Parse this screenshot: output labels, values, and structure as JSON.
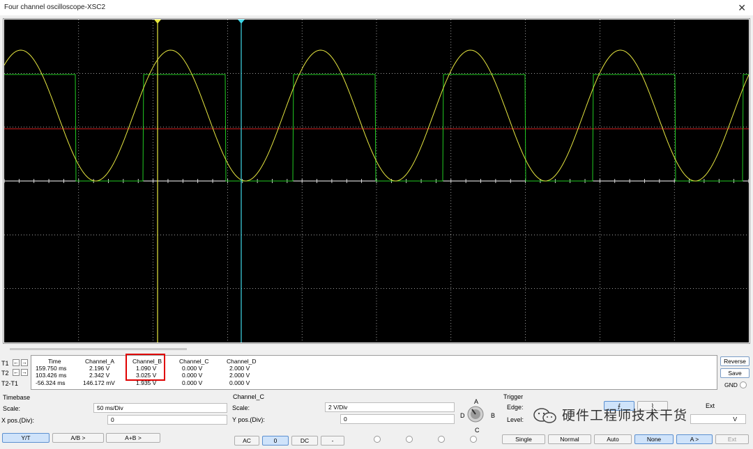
{
  "window": {
    "title": "Four channel oscilloscope-XSC2",
    "close_glyph": "✕"
  },
  "colors": {
    "trace_a": "#e8e840",
    "trace_b": "#22cc22",
    "trace_c": "#dd2222",
    "cursor_t1": "#e8e840",
    "cursor_t2": "#40d8e8",
    "grid": "#ffffff"
  },
  "readout": {
    "headers": [
      "Time",
      "Channel_A",
      "Channel_B",
      "Channel_C",
      "Channel_D"
    ],
    "rows": [
      {
        "label": "T1",
        "values": [
          "159.750 ms",
          "2.196 V",
          "1.090 V",
          "0.000 V",
          "2.000 V"
        ]
      },
      {
        "label": "T2",
        "values": [
          "103.426 ms",
          "2.342 V",
          "3.025 V",
          "0.000 V",
          "2.000 V"
        ]
      },
      {
        "label": "T2-T1",
        "values": [
          "-56.324 ms",
          "146.172 mV",
          "1.935 V",
          "0.000 V",
          "0.000 V"
        ]
      }
    ],
    "reverse_label": "Reverse",
    "save_label": "Save",
    "gnd_label": "GND"
  },
  "timebase": {
    "title": "Timebase",
    "scale_label": "Scale:",
    "scale_value": "50 ms/Div",
    "xpos_label": "X pos.(Div):",
    "xpos_value": "0",
    "modes": [
      "Y/T",
      "A/B >",
      "A+B >"
    ]
  },
  "channel": {
    "title": "Channel_C",
    "scale_label": "Scale:",
    "scale_value": "2  V/Div",
    "ypos_label": "Y pos.(Div):",
    "ypos_value": "0",
    "coupling": [
      "AC",
      "0",
      "DC",
      "-"
    ],
    "knob_labels": {
      "a": "A",
      "b": "B",
      "c": "C",
      "d": "D"
    }
  },
  "trigger": {
    "title": "Trigger",
    "edge_label": "Edge:",
    "level_label": "Level:",
    "level_unit": "V",
    "ext_label": "Ext",
    "modes": [
      "Single",
      "Normal",
      "Auto",
      "None"
    ],
    "source_a": "A >",
    "source_ext": "Ext"
  },
  "watermark": "硬件工程师技术干货"
}
